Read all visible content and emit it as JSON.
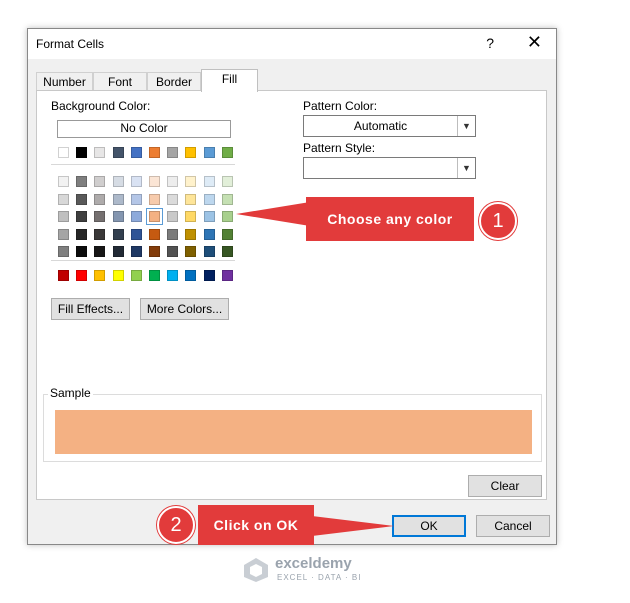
{
  "dialog": {
    "title": "Format Cells",
    "help_glyph": "?",
    "close_glyph": "✕"
  },
  "tabs": [
    {
      "label": "Number"
    },
    {
      "label": "Font"
    },
    {
      "label": "Border"
    },
    {
      "label": "Fill",
      "active": true
    }
  ],
  "fill": {
    "background_color_label": "Background Color:",
    "no_color_label": "No Color",
    "theme_colors_top": [
      "#ffffff",
      "#000000",
      "#e7e6e6",
      "#44546a",
      "#4472c4",
      "#ed7d31",
      "#a5a5a5",
      "#ffc000",
      "#5b9bd5",
      "#70ad47"
    ],
    "theme_shades": [
      [
        "#f2f2f2",
        "#7f7f7f",
        "#d0cece",
        "#d6dce4",
        "#d9e2f3",
        "#fbe5d5",
        "#ededed",
        "#fff2cc",
        "#deebf6",
        "#e2efd9"
      ],
      [
        "#d8d8d8",
        "#595959",
        "#aeabab",
        "#adb9ca",
        "#b4c6e7",
        "#f7cbac",
        "#dbdbdb",
        "#fee599",
        "#bdd7ee",
        "#c5e0b3"
      ],
      [
        "#bfbfbf",
        "#3f3f3f",
        "#757070",
        "#8496b0",
        "#8eaadb",
        "#f4b183",
        "#c9c9c9",
        "#ffd965",
        "#9cc3e5",
        "#a8d08d"
      ],
      [
        "#a5a5a5",
        "#262626",
        "#3a3838",
        "#323f4f",
        "#2f5496",
        "#c55a11",
        "#7b7b7b",
        "#bf9000",
        "#2e75b5",
        "#538135"
      ],
      [
        "#7f7f7f",
        "#0c0c0c",
        "#171616",
        "#222a35",
        "#1f3864",
        "#833c0b",
        "#525252",
        "#7f6000",
        "#1e4e79",
        "#375623"
      ]
    ],
    "standard_colors": [
      "#c00000",
      "#ff0000",
      "#ffc000",
      "#ffff00",
      "#92d050",
      "#00b050",
      "#00b0f0",
      "#0070c0",
      "#002060",
      "#7030a0"
    ],
    "fill_effects_label": "Fill Effects...",
    "more_colors_label": "More Colors...",
    "pattern_color_label": "Pattern Color:",
    "pattern_color_value": "Automatic",
    "pattern_style_label": "Pattern Style:",
    "pattern_style_value": "",
    "sample_label": "Sample",
    "sample_color": "#f4b183",
    "selected_swatch": "theme_shades.2.5",
    "clear_label": "Clear"
  },
  "footer": {
    "ok_label": "OK",
    "cancel_label": "Cancel"
  },
  "annotations": {
    "callout1_text": "Choose any color",
    "badge1": "1",
    "callout2_text": "Click on OK",
    "badge2": "2",
    "color": "#e23b3b"
  },
  "watermark": {
    "title": "exceldemy",
    "subtitle": "EXCEL · DATA · BI"
  }
}
